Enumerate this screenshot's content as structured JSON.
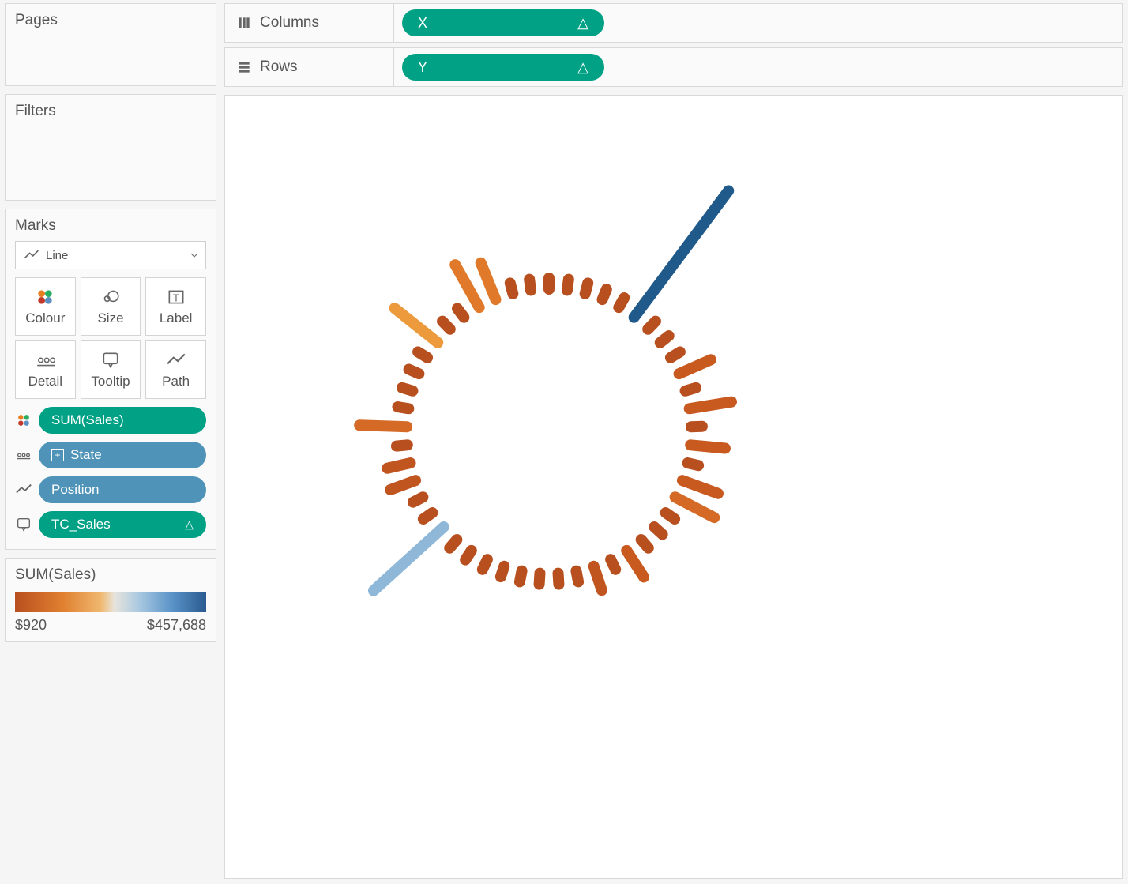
{
  "shelves": {
    "columns": {
      "label": "Columns",
      "pill": "X"
    },
    "rows": {
      "label": "Rows",
      "pill": "Y"
    }
  },
  "panels": {
    "pages": "Pages",
    "filters": "Filters",
    "marks": "Marks"
  },
  "marks": {
    "dropdown": "Line",
    "buttons": {
      "colour": "Colour",
      "size": "Size",
      "label": "Label",
      "detail": "Detail",
      "tooltip": "Tooltip",
      "path": "Path"
    },
    "pills": {
      "p0": "SUM(Sales)",
      "p1": "State",
      "p2": "Position",
      "p3": "TC_Sales"
    }
  },
  "legend": {
    "title": "SUM(Sales)",
    "min": "$920",
    "max": "$457,688"
  },
  "chart_data": {
    "type": "radial-bar",
    "center": [
      700,
      545
    ],
    "inner_radius": 180,
    "color_field": "SUM(Sales)",
    "color_range": [
      "#b84f1f",
      "#2a5a90"
    ],
    "color_domain": [
      920,
      457688
    ],
    "length_field": "SUM(Sales)",
    "bars": [
      {
        "angle": 0,
        "length": 14,
        "color": "#b84f1f"
      },
      {
        "angle": 7.35,
        "length": 14,
        "color": "#b84f1f"
      },
      {
        "angle": 14.69,
        "length": 14,
        "color": "#b84f1f"
      },
      {
        "angle": 22.04,
        "length": 14,
        "color": "#b84f1f"
      },
      {
        "angle": 29.39,
        "length": 14,
        "color": "#b84f1f"
      },
      {
        "angle": 36.73,
        "length": 200,
        "color": "#1f5a8a"
      },
      {
        "angle": 44.08,
        "length": 14,
        "color": "#b84f1f"
      },
      {
        "angle": 51.43,
        "length": 14,
        "color": "#b84f1f"
      },
      {
        "angle": 58.78,
        "length": 14,
        "color": "#b84f1f"
      },
      {
        "angle": 66.12,
        "length": 44,
        "color": "#c85a20"
      },
      {
        "angle": 73.47,
        "length": 14,
        "color": "#b84f1f"
      },
      {
        "angle": 80.82,
        "length": 54,
        "color": "#c85a20"
      },
      {
        "angle": 88.16,
        "length": 14,
        "color": "#b84f1f"
      },
      {
        "angle": 95.51,
        "length": 44,
        "color": "#c85a20"
      },
      {
        "angle": 102.86,
        "length": 14,
        "color": "#b84f1f"
      },
      {
        "angle": 110.2,
        "length": 48,
        "color": "#c85a20"
      },
      {
        "angle": 117.55,
        "length": 56,
        "color": "#d46a25"
      },
      {
        "angle": 124.9,
        "length": 14,
        "color": "#b84f1f"
      },
      {
        "angle": 132.24,
        "length": 14,
        "color": "#b84f1f"
      },
      {
        "angle": 139.59,
        "length": 14,
        "color": "#b84f1f"
      },
      {
        "angle": 146.94,
        "length": 40,
        "color": "#c85a20"
      },
      {
        "angle": 154.29,
        "length": 14,
        "color": "#b84f1f"
      },
      {
        "angle": 161.63,
        "length": 32,
        "color": "#c05520"
      },
      {
        "angle": 168.98,
        "length": 14,
        "color": "#b84f1f"
      },
      {
        "angle": 176.33,
        "length": 14,
        "color": "#b84f1f"
      },
      {
        "angle": 183.67,
        "length": 14,
        "color": "#b84f1f"
      },
      {
        "angle": 191.02,
        "length": 14,
        "color": "#b84f1f"
      },
      {
        "angle": 198.37,
        "length": 14,
        "color": "#b84f1f"
      },
      {
        "angle": 205.71,
        "length": 14,
        "color": "#b84f1f"
      },
      {
        "angle": 213.06,
        "length": 14,
        "color": "#b84f1f"
      },
      {
        "angle": 220.41,
        "length": 14,
        "color": "#b84f1f"
      },
      {
        "angle": 227.76,
        "length": 120,
        "color": "#8fb8d8"
      },
      {
        "angle": 235.1,
        "length": 14,
        "color": "#b84f1f"
      },
      {
        "angle": 242.45,
        "length": 14,
        "color": "#b84f1f"
      },
      {
        "angle": 249.8,
        "length": 34,
        "color": "#c05520"
      },
      {
        "angle": 257.14,
        "length": 30,
        "color": "#c05520"
      },
      {
        "angle": 264.49,
        "length": 14,
        "color": "#b84f1f"
      },
      {
        "angle": 271.84,
        "length": 60,
        "color": "#d46a25"
      },
      {
        "angle": 279.18,
        "length": 14,
        "color": "#b84f1f"
      },
      {
        "angle": 286.53,
        "length": 14,
        "color": "#b84f1f"
      },
      {
        "angle": 293.88,
        "length": 14,
        "color": "#b84f1f"
      },
      {
        "angle": 301.22,
        "length": 14,
        "color": "#b84f1f"
      },
      {
        "angle": 308.57,
        "length": 70,
        "color": "#ec9a3b"
      },
      {
        "angle": 315.92,
        "length": 14,
        "color": "#b84f1f"
      },
      {
        "angle": 323.27,
        "length": 14,
        "color": "#b84f1f"
      },
      {
        "angle": 330.61,
        "length": 62,
        "color": "#e07a2a"
      },
      {
        "angle": 337.96,
        "length": 50,
        "color": "#e07a2a"
      },
      {
        "angle": 345.31,
        "length": 14,
        "color": "#b84f1f"
      },
      {
        "angle": 352.65,
        "length": 14,
        "color": "#b84f1f"
      }
    ]
  }
}
